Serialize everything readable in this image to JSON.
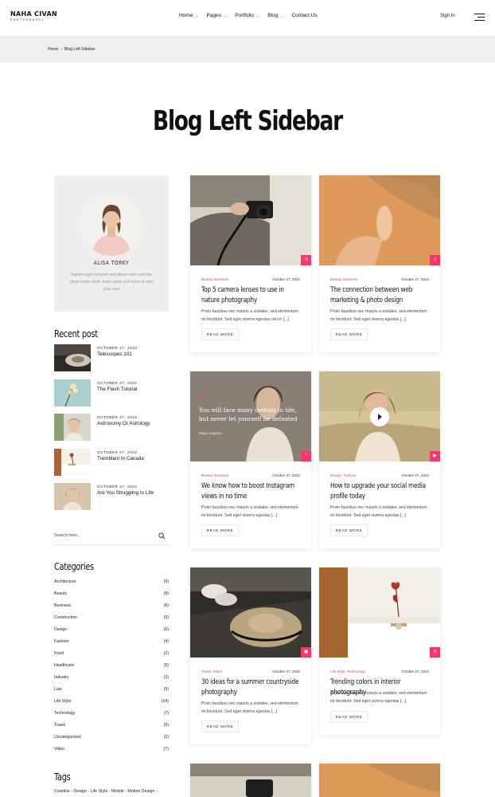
{
  "brand": {
    "name": "NAHA CIVAN",
    "tagline": "PHOTOGRAPHY"
  },
  "nav": {
    "items": [
      {
        "label": "Home",
        "chevron": true
      },
      {
        "label": "Pages",
        "chevron": true
      },
      {
        "label": "Portfolio",
        "chevron": true
      },
      {
        "label": "Blog",
        "chevron": true
      },
      {
        "label": "Contact Us",
        "chevron": false
      }
    ],
    "signin": "Sign In"
  },
  "breadcrumb": {
    "home": "Home",
    "sep": "-",
    "current": "Blog Left Sidebar"
  },
  "page": {
    "title": "Blog Left Sidebar"
  },
  "sidebar": {
    "profile": {
      "name": "ALISA TORKY",
      "bio": "Sapien eget mi proin sed libero enim sed tau cibus turpis diam maec enas sed enim ut sem plac erat"
    },
    "recent_heading": "Recent post",
    "recent": [
      {
        "date": "OCTOBER 27, 2022",
        "title": "Telescopes 101"
      },
      {
        "date": "OCTOBER 27, 2022",
        "title": "The Flash Tutorial"
      },
      {
        "date": "OCTOBER 27, 2022",
        "title": "Astronomy Or Astrology"
      },
      {
        "date": "OCTOBER 27, 2022",
        "title": "Tremblant In Canada"
      },
      {
        "date": "OCTOBER 27, 2022",
        "title": "Are You Struggling In Life"
      }
    ],
    "search_placeholder": "Search here...",
    "categories_heading": "Categories",
    "categories": [
      {
        "name": "Architecture",
        "count": "(5)"
      },
      {
        "name": "Beauty",
        "count": "(8)"
      },
      {
        "name": "Business",
        "count": "(6)"
      },
      {
        "name": "Construction",
        "count": "(5)"
      },
      {
        "name": "Design",
        "count": "(6)"
      },
      {
        "name": "Fashion",
        "count": "(4)"
      },
      {
        "name": "Food",
        "count": "(2)"
      },
      {
        "name": "Healthcare",
        "count": "(5)"
      },
      {
        "name": "Industry",
        "count": "(2)"
      },
      {
        "name": "Law",
        "count": "(5)"
      },
      {
        "name": "Life Style",
        "count": "(14)"
      },
      {
        "name": "Technology",
        "count": "(7)"
      },
      {
        "name": "Travel",
        "count": "(5)"
      },
      {
        "name": "Uncategorized",
        "count": "(2)"
      },
      {
        "name": "Video",
        "count": "(7)"
      }
    ],
    "tags_heading": "Tags",
    "tags": "Creative - Design - Life Style - Mobile - Motion Design -"
  },
  "posts": [
    {
      "category": "Beauty, Business",
      "date": "October 27, 2022",
      "title": "Top 5 camera lenses to use in nature photography",
      "excerpt": "Proin faucibus nec mauris a sodales, sed elementum mi tincidunt. Sed eget viverra egestas nisi in [...]",
      "button": "READ MORE",
      "badge_icon": "standard-post-icon"
    },
    {
      "category": "Beauty, Business",
      "date": "October 27, 2022",
      "title": "The connection between web marketing & photo design",
      "excerpt": "Proin faucibus nec mauris a sodales, sed elementum mi tincidunt. Sed eget viverra egestas [...]",
      "button": "READ MORE",
      "badge_icon": "audio-post-icon"
    },
    {
      "category": "Beauty, Business",
      "date": "October 27, 2022",
      "title": "We know how to boost Instagram views in no time",
      "excerpt": "Proin faucibus nec mauris a sodales, sed elementum mi tincidunt. Sed eget viverra egestas [...]",
      "button": "READ MORE",
      "badge_icon": "quote-post-icon",
      "quote_mark": "“",
      "quote": "You will face many defeats in life, but never let yourself be defeated",
      "quote_author": "Maya Angelou"
    },
    {
      "category": "Design, Fashion",
      "date": "October 27, 2022",
      "title": "How to upgrade your social media profile today",
      "excerpt": "Proin faucibus nec mauris a sodales, sed elementum mi tincidunt. Sed eget viverra egestas [...]",
      "button": "READ MORE",
      "badge_icon": "video-post-icon"
    },
    {
      "category": "Travel, Video",
      "date": "October 27, 2022",
      "title": "30 ideas for a summer countryside photography",
      "excerpt": "Proin faucibus nec mauris a sodales, sed elementum mi tincidunt. Sed eget viverra egestas [...]",
      "button": "READ MORE",
      "badge_icon": "gallery-post-icon"
    },
    {
      "category": "Life Style, Technology",
      "date": "October 27, 2022",
      "title": "Trending colors in interior photography",
      "excerpt": "Proin faucibus nec mauris a sodales, sed elementum mi tincidunt. Sed eget viverra egestas [...]",
      "button": "READ MORE",
      "badge_icon": "standard-post-icon"
    }
  ],
  "colors": {
    "accent": "#ef3a6b",
    "panel": "#efeeec",
    "bar": "#efefef"
  }
}
